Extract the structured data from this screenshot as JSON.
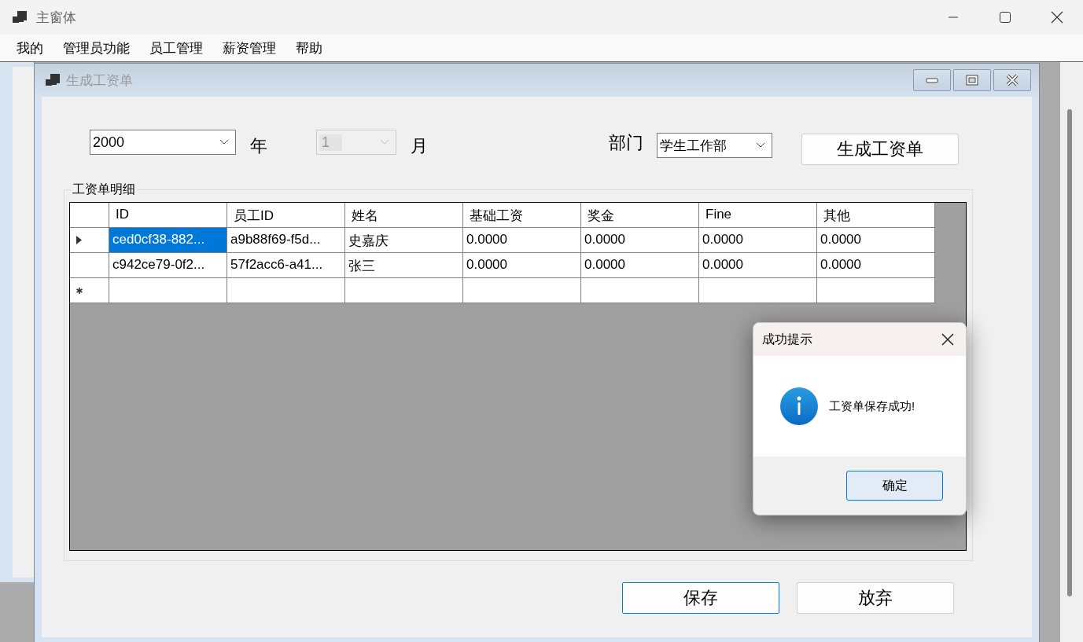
{
  "window": {
    "title": "主窗体"
  },
  "menu": [
    {
      "label": "我的"
    },
    {
      "label": "管理员功能"
    },
    {
      "label": "员工管理"
    },
    {
      "label": "薪资管理"
    },
    {
      "label": "帮助"
    }
  ],
  "child_window": {
    "title": "生成工资单"
  },
  "year": {
    "value": "2000",
    "disabled": false
  },
  "year_label": "年",
  "month": {
    "value": "1",
    "disabled": true
  },
  "month_label": "月",
  "department_label": "部门",
  "department": {
    "value": "学生工作部",
    "disabled": false
  },
  "generate_button": "生成工资单",
  "group": {
    "title": "工资单明细"
  },
  "table": {
    "columns": [
      "ID",
      "员工ID",
      "姓名",
      "基础工资",
      "奖金",
      "Fine",
      "其他"
    ],
    "rows": [
      {
        "kind": "data",
        "current": true,
        "cells": [
          {
            "text": "ced0cf38-882...",
            "selected": true
          },
          {
            "text": "a9b88f69-f5d...",
            "selected": false
          },
          {
            "text": "史嘉庆",
            "selected": false
          },
          {
            "text": "0.0000",
            "selected": false
          },
          {
            "text": "0.0000",
            "selected": false
          },
          {
            "text": "0.0000",
            "selected": false
          },
          {
            "text": "0.0000",
            "selected": false
          }
        ]
      },
      {
        "kind": "data",
        "current": false,
        "cells": [
          {
            "text": "c942ce79-0f2...",
            "selected": false
          },
          {
            "text": "57f2acc6-a41...",
            "selected": false
          },
          {
            "text": "张三",
            "selected": false
          },
          {
            "text": "0.0000",
            "selected": false
          },
          {
            "text": "0.0000",
            "selected": false
          },
          {
            "text": "0.0000",
            "selected": false
          },
          {
            "text": "0.0000",
            "selected": false
          }
        ]
      },
      {
        "kind": "new",
        "cells": []
      }
    ]
  },
  "buttons": [
    {
      "label": "保存",
      "focused": true
    },
    {
      "label": "放弃",
      "focused": false
    }
  ],
  "dialog": {
    "title": "成功提示",
    "message": "工资单保存成功!",
    "button": "确定"
  }
}
